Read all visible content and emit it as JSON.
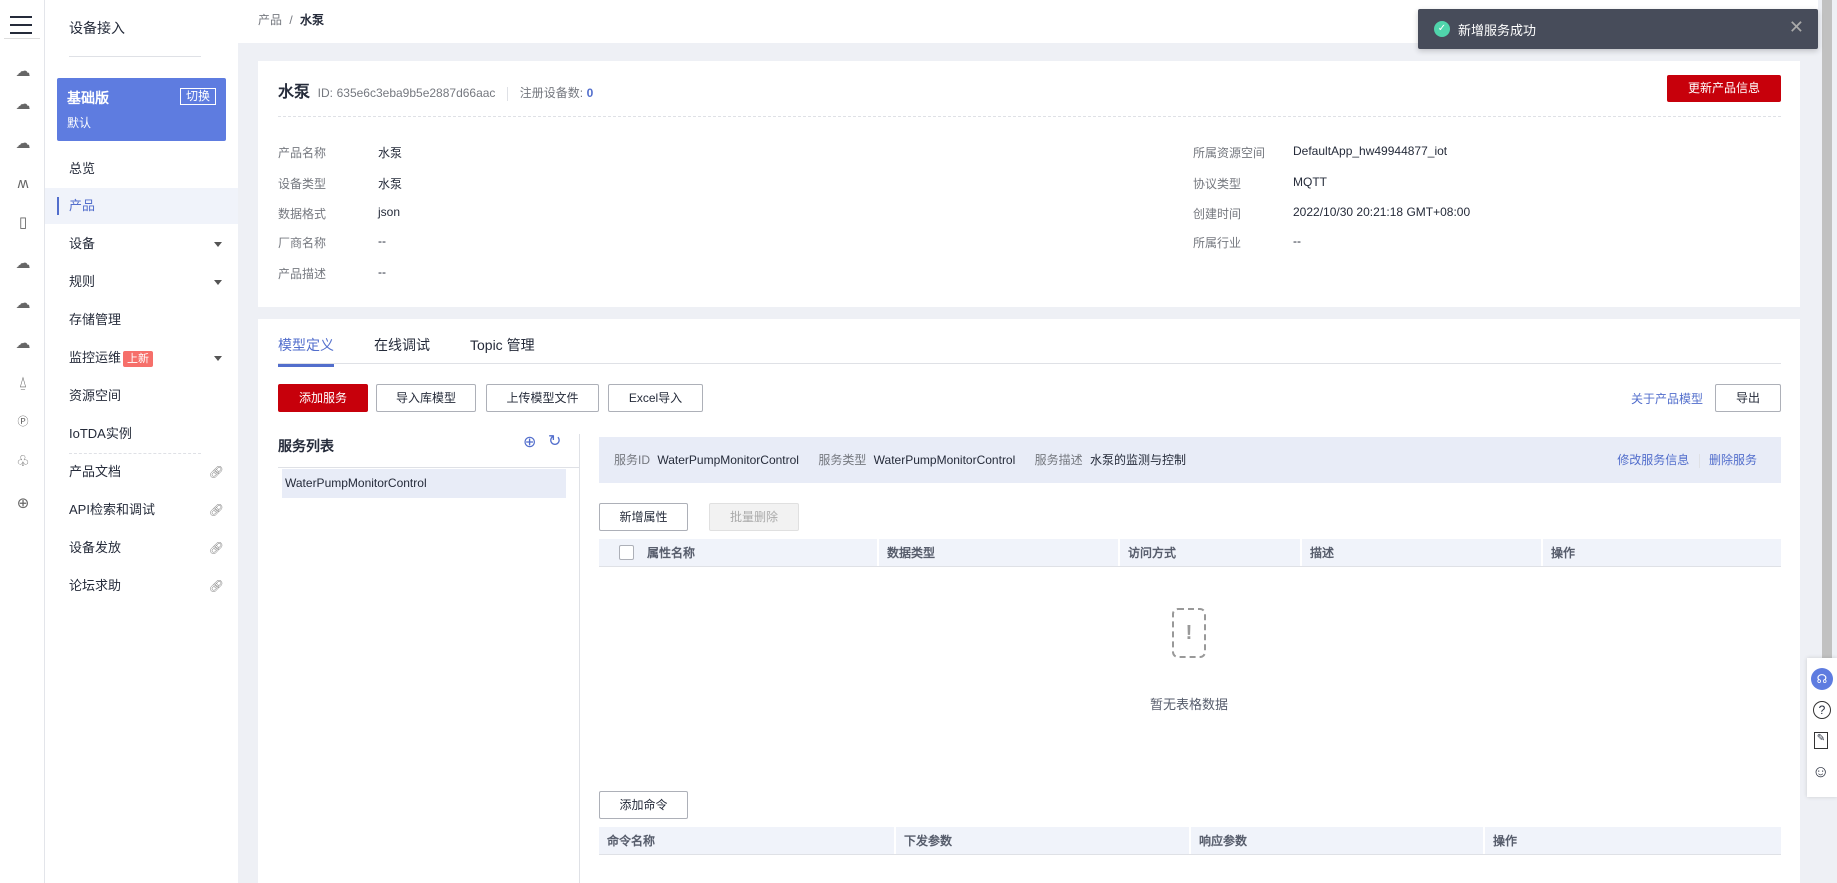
{
  "rail_icons": [
    "menu-icon",
    "cloud-device-icon",
    "cloud-dots-icon",
    "cloud-storage-icon",
    "signal-wave-icon",
    "phone-cloud-icon",
    "cloud-icon",
    "cloud-upload-icon",
    "cloud-gauge-icon",
    "antenna-icon",
    "ip-icon",
    "cluster-icon",
    "globe-icon"
  ],
  "sidebar": {
    "title": "设备接入",
    "edition": {
      "name": "基础版",
      "switch": "切换",
      "instance": "默认"
    },
    "items": [
      {
        "label": "总览"
      },
      {
        "label": "产品",
        "active": true
      },
      {
        "label": "设备",
        "expandable": true
      },
      {
        "label": "规则",
        "expandable": true
      },
      {
        "label": "存储管理"
      },
      {
        "label": "监控运维",
        "badge": "上新",
        "expandable": true
      },
      {
        "label": "资源空间"
      },
      {
        "label": "IoTDA实例"
      }
    ],
    "links": [
      {
        "label": "产品文档"
      },
      {
        "label": "API检索和调试"
      },
      {
        "label": "设备发放"
      },
      {
        "label": "论坛求助"
      }
    ]
  },
  "breadcrumb": {
    "parent": "产品",
    "sep": "/",
    "current": "水泵"
  },
  "toast": {
    "message": "新增服务成功",
    "color": "#474c5a"
  },
  "product": {
    "name": "水泵",
    "id_label": "ID:",
    "id": "635e6c3eba9b5e2887d66aac",
    "device_count_label": "注册设备数:",
    "device_count": "0",
    "update_button": "更新产品信息",
    "left": [
      {
        "label": "产品名称",
        "value": "水泵"
      },
      {
        "label": "设备类型",
        "value": "水泵"
      },
      {
        "label": "数据格式",
        "value": "json"
      },
      {
        "label": "厂商名称",
        "value": "--"
      },
      {
        "label": "产品描述",
        "value": "--"
      }
    ],
    "right": [
      {
        "label": "所属资源空间",
        "value": "DefaultApp_hw49944877_iot"
      },
      {
        "label": "协议类型",
        "value": "MQTT"
      },
      {
        "label": "创建时间",
        "value": "2022/10/30 20:21:18 GMT+08:00"
      },
      {
        "label": "所属行业",
        "value": "--"
      }
    ]
  },
  "tabs": [
    {
      "label": "模型定义",
      "active": true
    },
    {
      "label": "在线调试"
    },
    {
      "label": "Topic 管理"
    }
  ],
  "toolbar": {
    "add_service": "添加服务",
    "import_lib": "导入库模型",
    "upload_model": "上传模型文件",
    "excel_import": "Excel导入",
    "about_model": "关于产品模型",
    "export": "导出"
  },
  "service_list": {
    "title": "服务列表",
    "items": [
      "WaterPumpMonitorControl"
    ]
  },
  "service_info": {
    "id_label": "服务ID",
    "id": "WaterPumpMonitorControl",
    "type_label": "服务类型",
    "type": "WaterPumpMonitorControl",
    "desc_label": "服务描述",
    "desc": "水泵的监测与控制",
    "edit": "修改服务信息",
    "delete": "删除服务"
  },
  "properties": {
    "add": "新增属性",
    "batch_delete": "批量删除",
    "columns": [
      "属性名称",
      "数据类型",
      "访问方式",
      "描述",
      "操作"
    ],
    "empty": "暂无表格数据"
  },
  "commands": {
    "add": "添加命令",
    "columns": [
      "命令名称",
      "下发参数",
      "响应参数",
      "操作"
    ]
  },
  "float_icons": [
    "customer-service-icon",
    "help-icon",
    "feedback-icon",
    "smile-icon"
  ]
}
